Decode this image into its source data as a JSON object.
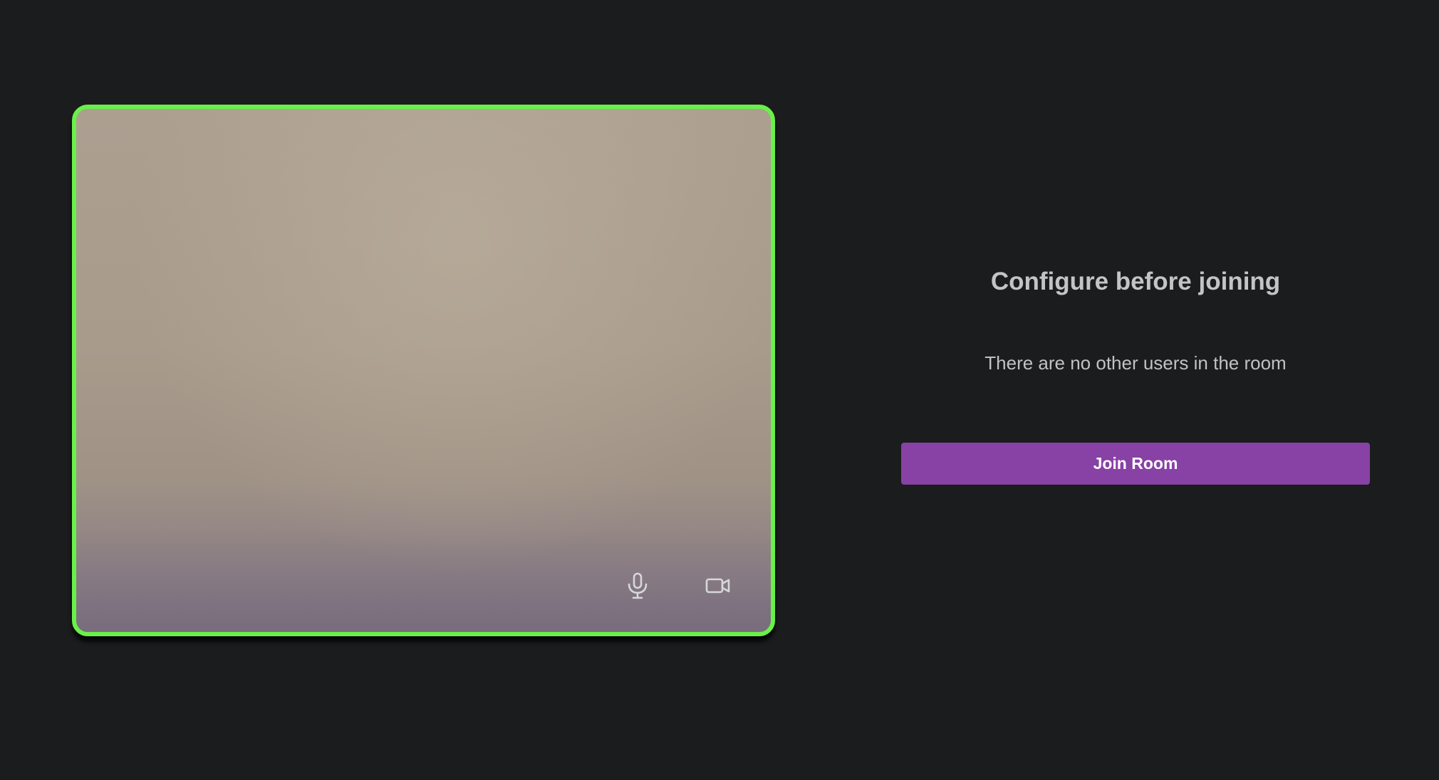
{
  "preview": {
    "controls": {
      "microphone_icon": "microphone-icon",
      "camera_icon": "video-camera-icon"
    },
    "border_color": "#6af04a"
  },
  "lobby": {
    "title": "Configure before joining",
    "status": "There are no other users in the room",
    "join_button_label": "Join Room"
  },
  "colors": {
    "background": "#1b1c1e",
    "accent": "#8841a5",
    "active_border": "#6af04a"
  }
}
